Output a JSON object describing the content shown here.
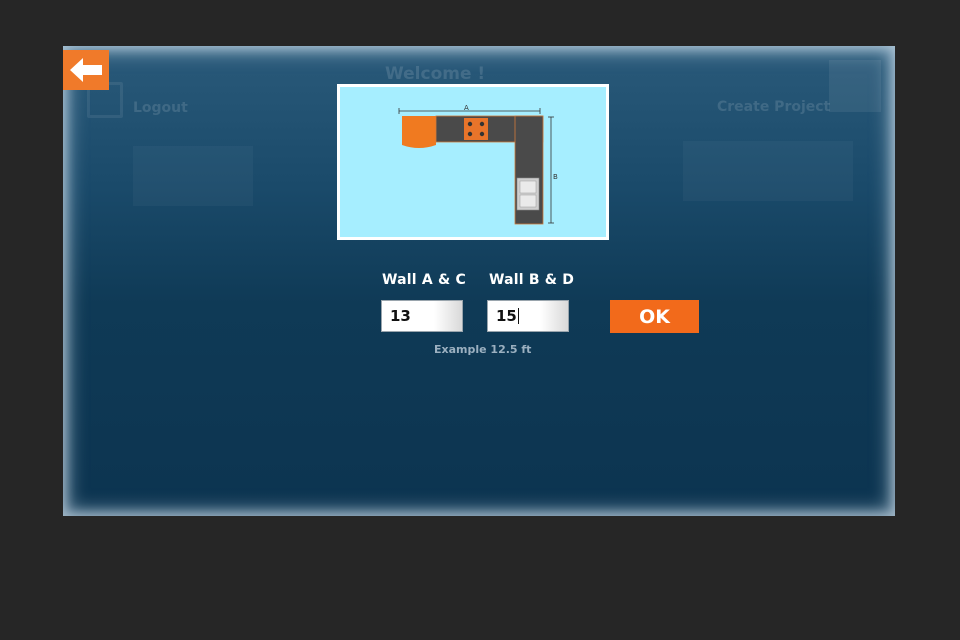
{
  "background": {
    "welcome": "Welcome !",
    "logout": "Logout",
    "create_project": "Create Project"
  },
  "back_button": {
    "icon": "arrow-left-icon",
    "color": "#f07a2a"
  },
  "diagram": {
    "label_a": "A",
    "label_b": "B"
  },
  "form": {
    "wall_ac_label": "Wall A & C",
    "wall_bd_label": "Wall B & D",
    "wall_ac_value": "13",
    "wall_bd_value": "15",
    "hint": "Example 12.5 ft",
    "ok_label": "OK"
  },
  "colors": {
    "accent": "#f26a1b",
    "panel": "#0f3a56",
    "diagram_bg": "#a6eeff"
  }
}
